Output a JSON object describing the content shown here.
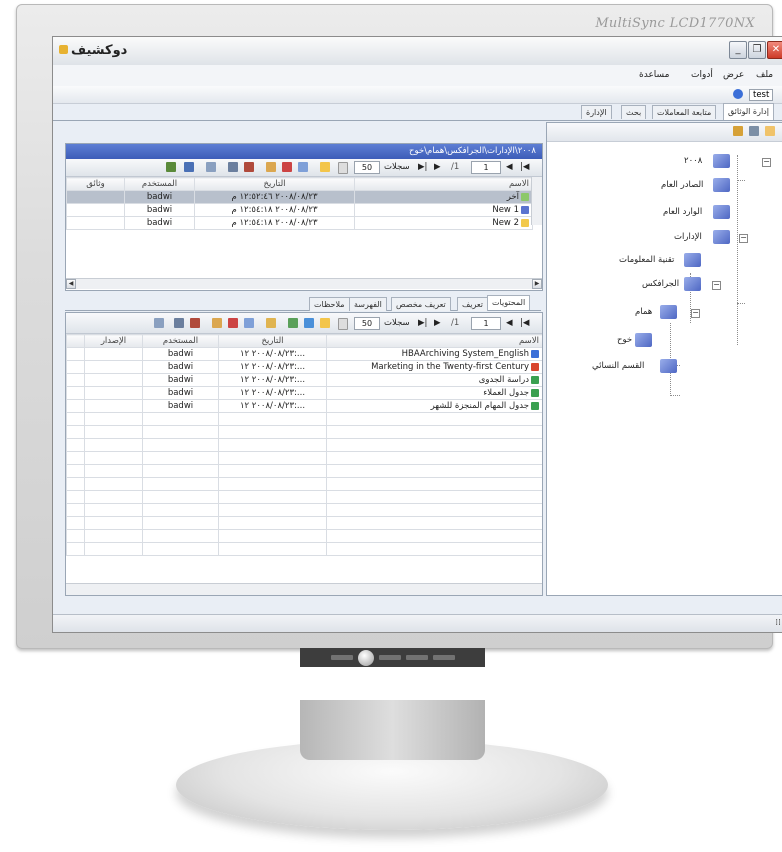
{
  "monitor": {
    "brand": "MultiSync LCD1770NX"
  },
  "window": {
    "title": "دوكشيف",
    "min_icon": "minimize-icon",
    "max_icon": "maximize-icon",
    "close_icon": "close-icon"
  },
  "menu": {
    "file": "ملف",
    "view": "عرض",
    "tools": "أدوات",
    "help": "مساعدة"
  },
  "toolbar": {
    "user": "test"
  },
  "tabs": [
    "إدارة الوثائق",
    "متابعة المعاملات",
    "بحث",
    "الإدارة"
  ],
  "tree": {
    "root": "٢٠٠٨",
    "items": [
      "الصادر العام",
      "الوارد العام",
      "الإدارات",
      "تقنية المعلومات",
      "الجرافكس",
      "همام",
      "خوح",
      "القسم النسائي"
    ]
  },
  "top_panel": {
    "path": "٢٠٠٨\\الإدارات\\الجرافكس\\همام\\خوح",
    "nav": {
      "position": "1",
      "of": "/1",
      "records": "سجلات",
      "page_size": "50"
    },
    "columns": [
      "الاسم",
      "التاريخ",
      "المستخدم",
      "وثائق"
    ],
    "rows": [
      {
        "name": "آخر",
        "date": "٢٠٠٨/٠٨/٢٣ ١٢:٥٢:٤٦ م",
        "user": "badwi",
        "docs": ""
      },
      {
        "name": "New 1",
        "date": "٢٠٠٨/٠٨/٢٣ ١٢:٥٤:١٨ م",
        "user": "badwi",
        "docs": ""
      },
      {
        "name": "New 2",
        "date": "٢٠٠٨/٠٨/٢٣ ١٢:٥٤:١٨ م",
        "user": "badwi",
        "docs": ""
      }
    ]
  },
  "sub_tabs": [
    "المحتويات",
    "تعريف",
    "تعريف مخصص",
    "الفهرسة",
    "ملاحظات"
  ],
  "bottom_panel": {
    "nav": {
      "position": "1",
      "of": "/1",
      "records": "سجلات",
      "page_size": "50"
    },
    "columns": [
      "الاسم",
      "التاريخ",
      "المستخدم",
      "الإصدار"
    ],
    "rows": [
      {
        "name": "HBAArchiving System_English",
        "date": "٢٠٠٨/٠٨/٢٣ ١٢:...",
        "user": "badwi",
        "version": ""
      },
      {
        "name": "Marketing in the Twenty-first Century",
        "date": "٢٠٠٨/٠٨/٢٣ ١٢:...",
        "user": "badwi",
        "version": ""
      },
      {
        "name": "دراسة الجدوى",
        "date": "٢٠٠٨/٠٨/٢٣ ١٢:...",
        "user": "badwi",
        "version": ""
      },
      {
        "name": "جدول العملاء",
        "date": "٢٠٠٨/٠٨/٢٣ ١٢:...",
        "user": "badwi",
        "version": ""
      },
      {
        "name": "جدول المهام المنجزة للشهر",
        "date": "٢٠٠٨/٠٨/٢٣ ١٢:...",
        "user": "badwi",
        "version": ""
      }
    ]
  },
  "statusbar": {
    "grip": "⁞⁞"
  },
  "colors": {
    "title_blue": "#3d5db8",
    "folder": "#5b74cf",
    "selection": "#b8c0cc"
  }
}
